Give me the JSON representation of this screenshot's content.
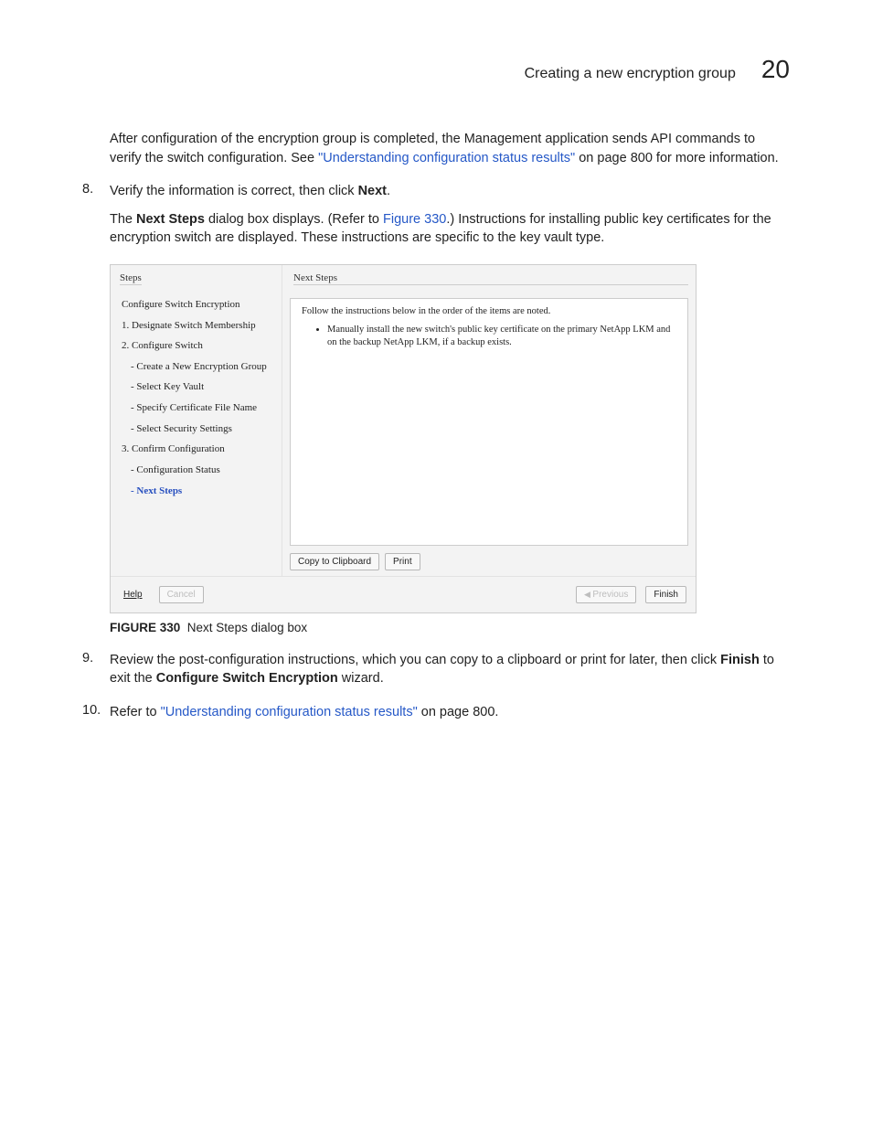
{
  "header": {
    "title": "Creating a new encryption group",
    "chapter": "20"
  },
  "intro": {
    "p1a": "After configuration of the encryption group is completed, the Management application sends API commands to verify the switch configuration. See ",
    "link1": "\"Understanding configuration status results\"",
    "p1b": " on page 800 for more information."
  },
  "steps": {
    "n8": "8.",
    "s8a": "Verify the information is correct, then click ",
    "s8bold": "Next",
    "s8c": ".",
    "s8_sub_a": "The ",
    "s8_sub_bold": "Next Steps",
    "s8_sub_b": " dialog box displays. (Refer to ",
    "s8_sub_link": "Figure 330",
    "s8_sub_c": ".) Instructions for installing public key certificates for the encryption switch are displayed. These instructions are specific to the key vault type.",
    "n9": "9.",
    "s9a": "Review the post-configuration instructions, which you can copy to a clipboard or print for later, then click ",
    "s9b1": "Finish",
    "s9b2": " to exit the ",
    "s9b3": "Configure Switch Encryption",
    "s9b4": " wizard.",
    "n10": "10.",
    "s10a": "Refer to ",
    "s10link": "\"Understanding configuration status results\"",
    "s10b": " on page 800."
  },
  "figure": {
    "label": "FIGURE 330",
    "caption": "Next Steps dialog box",
    "left_title": "Steps",
    "right_title": "Next Steps",
    "follow": "Follow the instructions below in the order of the items are noted.",
    "bullet": "Manually install the new switch's public key certificate on the primary NetApp LKM and on the backup NetApp LKM, if a backup exists.",
    "copy": "Copy to Clipboard",
    "print": "Print",
    "help": "Help",
    "cancel": "Cancel",
    "previous": "Previous",
    "finish": "Finish",
    "items": [
      {
        "text": "Configure Switch Encryption",
        "sub": false
      },
      {
        "text": "1. Designate Switch Membership",
        "sub": false
      },
      {
        "text": "2. Configure Switch",
        "sub": false
      },
      {
        "text": "- Create a New Encryption Group",
        "sub": true
      },
      {
        "text": "- Select Key Vault",
        "sub": true
      },
      {
        "text": "- Specify Certificate File Name",
        "sub": true
      },
      {
        "text": "- Select Security Settings",
        "sub": true
      },
      {
        "text": "3. Confirm Configuration",
        "sub": false
      },
      {
        "text": "- Configuration Status",
        "sub": true
      },
      {
        "text": "- Next Steps",
        "sub": true,
        "current": true
      }
    ]
  }
}
